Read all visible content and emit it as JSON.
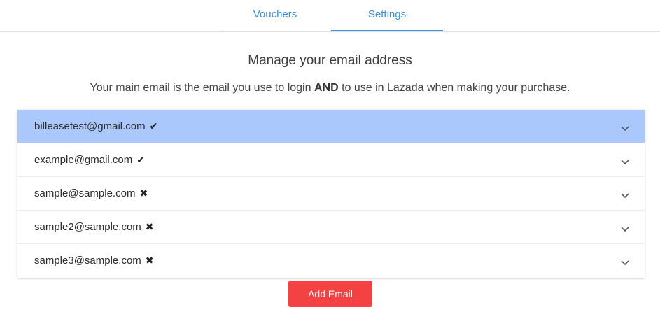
{
  "tabs": [
    {
      "label": "Vouchers",
      "active": false
    },
    {
      "label": "Settings",
      "active": true
    }
  ],
  "heading": "Manage your email address",
  "subtext": {
    "before": "Your main email is the email you use to login ",
    "bold": "AND",
    "after": " to use in Lazada when making your purchase."
  },
  "emails": [
    {
      "address": "billeasetest@gmail.com",
      "status_icon": "✔",
      "status_icon_name": "check-icon",
      "selected": true
    },
    {
      "address": "example@gmail.com",
      "status_icon": "✔",
      "status_icon_name": "check-icon",
      "selected": false
    },
    {
      "address": "sample@sample.com",
      "status_icon": "✖",
      "status_icon_name": "cross-icon",
      "selected": false
    },
    {
      "address": "sample2@sample.com",
      "status_icon": "✖",
      "status_icon_name": "cross-icon",
      "selected": false
    },
    {
      "address": "sample3@sample.com",
      "status_icon": "✖",
      "status_icon_name": "cross-icon",
      "selected": false
    }
  ],
  "add_button_label": "Add Email",
  "colors": {
    "accent": "#3a8ee6",
    "selected_row": "#aac8fb",
    "add_button": "#f44242"
  }
}
